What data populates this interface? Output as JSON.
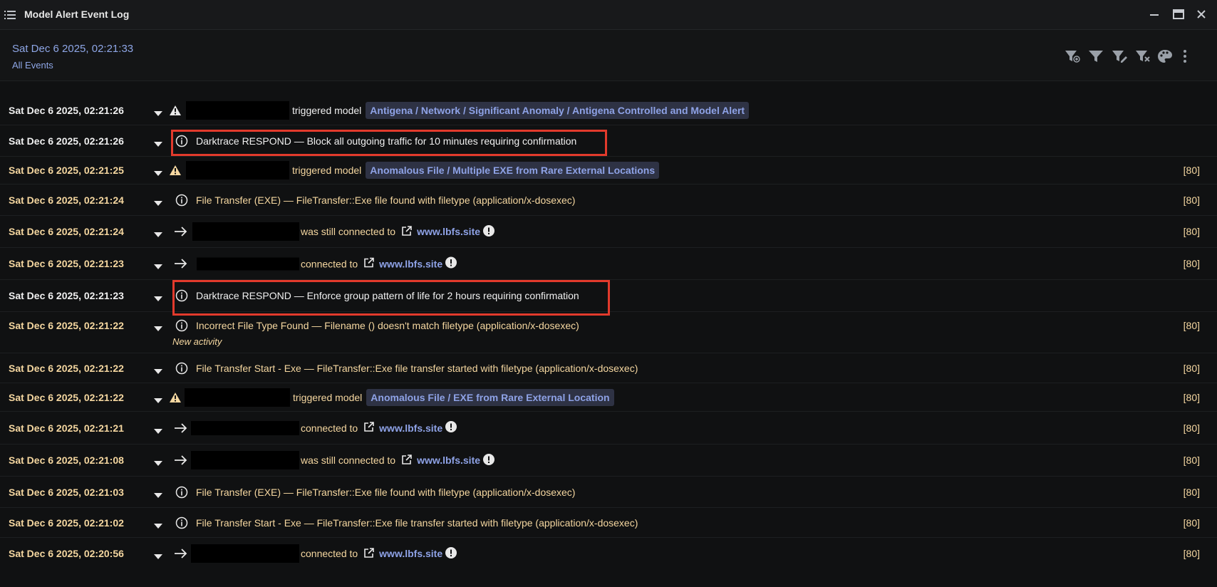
{
  "window": {
    "title": "Model Alert Event Log"
  },
  "header": {
    "datetime": "Sat Dec 6 2025, 02:21:33",
    "filter": "All Events"
  },
  "toolbar_icons": [
    "filter-add-icon",
    "filter-icon",
    "filter-edit-icon",
    "filter-remove-icon",
    "palette-icon",
    "more-vertical-icon"
  ],
  "colors": {
    "accent_blue": "#8ea2e6",
    "gold_text": "#f5d7a0",
    "highlight_red": "#e23a2c",
    "tag_bg": "#2e3244"
  },
  "events": [
    {
      "timestamp": "Sat Dec 6 2025, 02:21:26",
      "icon": "warning-icon",
      "pre": "",
      "verb": "triggered model",
      "model": "Antigena / Network / Significant Anomaly / Antigena Controlled and Model Alert",
      "score": ""
    },
    {
      "timestamp": "Sat Dec 6 2025, 02:21:26",
      "icon": "info-icon",
      "text": "Darktrace RESPOND — Block all outgoing traffic for 10 minutes requiring confirmation",
      "score": ""
    },
    {
      "timestamp": "Sat Dec 6 2025, 02:21:25",
      "icon": "warning-icon",
      "verb": "triggered model",
      "model": "Anomalous File / Multiple EXE from Rare External Locations",
      "score": "[80]"
    },
    {
      "timestamp": "Sat Dec 6 2025, 02:21:24",
      "icon": "info-icon",
      "text": "File Transfer (EXE) — FileTransfer::Exe file found with filetype (application/x-dosexec)",
      "score": "[80]"
    },
    {
      "timestamp": "Sat Dec 6 2025, 02:21:24",
      "icon": "arrow-right-icon",
      "verb": "was still connected to",
      "link": "www.lbfs.site",
      "score": "[80]"
    },
    {
      "timestamp": "Sat Dec 6 2025, 02:21:23",
      "icon": "arrow-right-icon",
      "verb": "connected to",
      "link": "www.lbfs.site",
      "score": "[80]"
    },
    {
      "timestamp": "Sat Dec 6 2025, 02:21:23",
      "icon": "info-icon",
      "text": "Darktrace RESPOND — Enforce group pattern of life for 2 hours requiring confirmation",
      "score": ""
    },
    {
      "timestamp": "Sat Dec 6 2025, 02:21:22",
      "icon": "info-icon",
      "text": "Incorrect File Type Found — Filename () doesn't match filetype (application/x-dosexec)",
      "sub": "New activity",
      "score": "[80]"
    },
    {
      "timestamp": "Sat Dec 6 2025, 02:21:22",
      "icon": "info-icon",
      "text": "File Transfer Start - Exe — FileTransfer::Exe file transfer started with filetype (application/x-dosexec)",
      "score": "[80]"
    },
    {
      "timestamp": "Sat Dec 6 2025, 02:21:22",
      "icon": "warning-icon",
      "verb": "triggered model",
      "model": "Anomalous File / EXE from Rare External Location",
      "score": "[80]"
    },
    {
      "timestamp": "Sat Dec 6 2025, 02:21:21",
      "icon": "arrow-right-icon",
      "verb": "connected to",
      "link": "www.lbfs.site",
      "score": "[80]"
    },
    {
      "timestamp": "Sat Dec 6 2025, 02:21:08",
      "icon": "arrow-right-icon",
      "verb": "was still connected to",
      "link": "www.lbfs.site",
      "score": "[80]"
    },
    {
      "timestamp": "Sat Dec 6 2025, 02:21:03",
      "icon": "info-icon",
      "text": "File Transfer (EXE) — FileTransfer::Exe file found with filetype (application/x-dosexec)",
      "score": "[80]"
    },
    {
      "timestamp": "Sat Dec 6 2025, 02:21:02",
      "icon": "info-icon",
      "text": "File Transfer Start - Exe — FileTransfer::Exe file transfer started with filetype (application/x-dosexec)",
      "score": "[80]"
    },
    {
      "timestamp": "Sat Dec 6 2025, 02:20:56",
      "icon": "arrow-right-icon",
      "verb": "connected to",
      "link": "www.lbfs.site",
      "score": "[80]"
    }
  ]
}
